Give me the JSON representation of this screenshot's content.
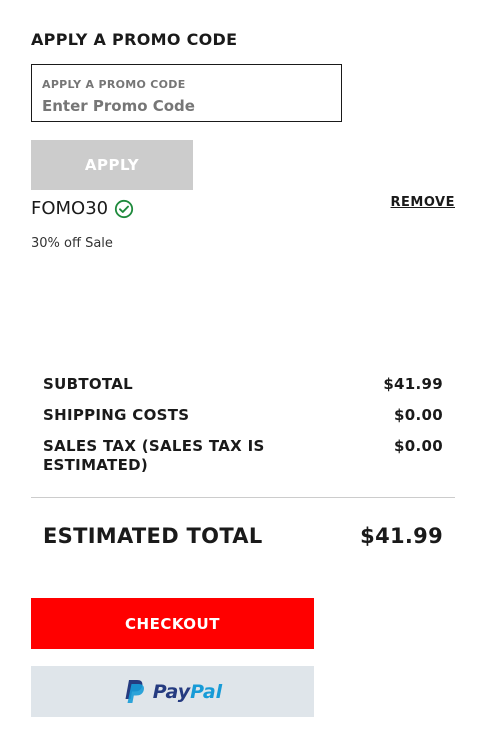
{
  "promo": {
    "heading": "APPLY A PROMO CODE",
    "field_label": "APPLY A PROMO CODE",
    "input_placeholder": "Enter Promo Code",
    "input_value": "",
    "apply_label": "APPLY"
  },
  "applied_promo": {
    "code": "FOMO30",
    "status_icon": "check-circle-icon",
    "remove_label": "REMOVE",
    "description": "30% off Sale"
  },
  "summary": {
    "subtotal_label": "SUBTOTAL",
    "subtotal_value": "$41.99",
    "shipping_label": "SHIPPING COSTS",
    "shipping_value": "$0.00",
    "tax_label": "SALES TAX (SALES TAX IS ESTIMATED)",
    "tax_value": "$0.00",
    "total_label": "ESTIMATED TOTAL",
    "total_value": "$41.99"
  },
  "actions": {
    "checkout_label": "CHECKOUT",
    "paypal_pay": "Pay",
    "paypal_pal": "Pal"
  },
  "colors": {
    "checkout": "#ff0000",
    "apply_disabled": "#cccccc",
    "paypal_bg": "#dfe5ea",
    "success_green": "#1e8a3c",
    "paypal_dark": "#253b80",
    "paypal_light": "#179bd7"
  }
}
